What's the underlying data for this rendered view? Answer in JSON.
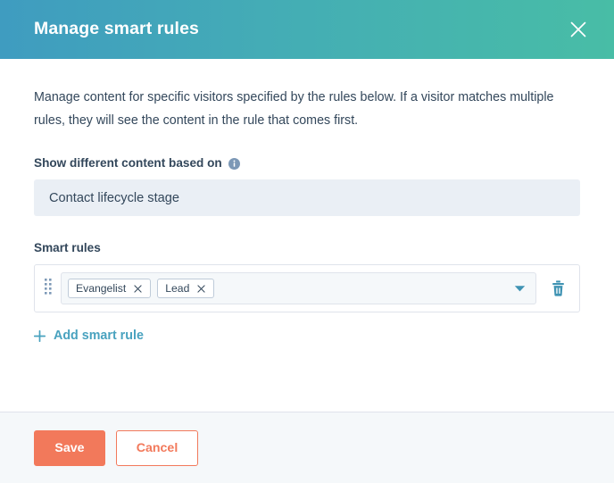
{
  "header": {
    "title": "Manage smart rules",
    "close_icon": "close-icon",
    "gradient_from": "#3f9cc0",
    "gradient_mid": "#44adb5",
    "gradient_to": "#48bda6"
  },
  "body": {
    "description": "Manage content for specific visitors specified by the rules below. If a visitor matches multiple rules, they will see the content in the rule that comes first.",
    "criteria": {
      "label": "Show different content based on",
      "info_icon": "info-icon",
      "value": "Contact lifecycle stage"
    },
    "rules_section": {
      "label": "Smart rules",
      "rules": [
        {
          "drag_icon": "drag-handle-icon",
          "tags": [
            {
              "label": "Evangelist",
              "remove_icon": "close-icon"
            },
            {
              "label": "Lead",
              "remove_icon": "close-icon"
            }
          ],
          "caret_icon": "chevron-down-icon",
          "delete_icon": "trash-icon"
        }
      ],
      "add_rule_label": "Add smart rule",
      "add_rule_icon": "plus-icon"
    }
  },
  "footer": {
    "save_label": "Save",
    "cancel_label": "Cancel",
    "primary_color": "#f2795b"
  }
}
